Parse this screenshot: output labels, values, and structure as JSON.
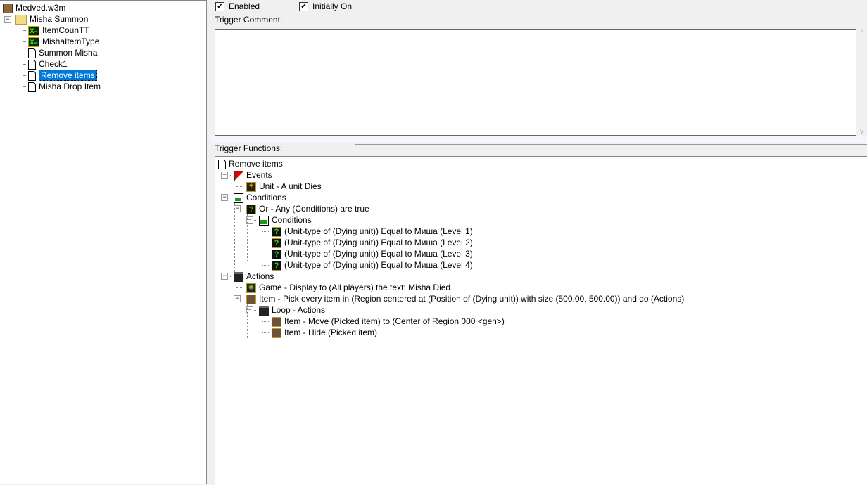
{
  "left_tree": {
    "root": "Medved.w3m",
    "folder": "Misha Summon",
    "items": [
      {
        "label": "ItemCounTT",
        "icon": "variable-icon"
      },
      {
        "label": "MishaItemType",
        "icon": "variable-icon"
      },
      {
        "label": "Summon Misha",
        "icon": "trigger-icon"
      },
      {
        "label": "Check1",
        "icon": "trigger-icon"
      },
      {
        "label": "Remove items",
        "icon": "trigger-icon",
        "selected": true
      },
      {
        "label": "Misha Drop Item",
        "icon": "trigger-icon"
      }
    ]
  },
  "options": {
    "enabled_label": "Enabled",
    "enabled": true,
    "initially_on_label": "Initially On",
    "initially_on": true
  },
  "comment": {
    "label": "Trigger Comment:",
    "value": ""
  },
  "functions": {
    "label": "Trigger Functions:",
    "rows": [
      {
        "text": "Remove items",
        "level": 0,
        "icon": "doc"
      },
      {
        "text": "Events",
        "level": 1,
        "icon": "flag",
        "exp": true
      },
      {
        "text": "Unit - A unit Dies",
        "level": 2,
        "icon": "unit"
      },
      {
        "text": "Conditions",
        "level": 1,
        "icon": "cond",
        "exp": true
      },
      {
        "text": "Or - Any (Conditions) are true",
        "level": 2,
        "icon": "q",
        "exp": true
      },
      {
        "text": "Conditions",
        "level": 3,
        "icon": "cond",
        "exp": true
      },
      {
        "text": "(Unit-type of (Dying unit)) Equal to Миша (Level 1)",
        "level": 4,
        "icon": "q"
      },
      {
        "text": "(Unit-type of (Dying unit)) Equal to Миша (Level 2)",
        "level": 4,
        "icon": "q"
      },
      {
        "text": "(Unit-type of (Dying unit)) Equal to Миша (Level 3)",
        "level": 4,
        "icon": "q"
      },
      {
        "text": "(Unit-type of (Dying unit)) Equal to Миша (Level 4)",
        "level": 4,
        "icon": "q"
      },
      {
        "text": "Actions",
        "level": 1,
        "icon": "clap",
        "exp": true
      },
      {
        "text": "Game - Display to (All players) the text: Misha Died",
        "level": 2,
        "icon": "game"
      },
      {
        "text": "Item - Pick every item in (Region centered at (Position of (Dying unit)) with size (500.00, 500.00)) and do (Actions)",
        "level": 2,
        "icon": "item",
        "exp": true
      },
      {
        "text": "Loop - Actions",
        "level": 3,
        "icon": "clap",
        "exp": true
      },
      {
        "text": "Item - Move (Picked item) to (Center of Region 000 <gen>)",
        "level": 4,
        "icon": "item"
      },
      {
        "text": "Item - Hide (Picked item)",
        "level": 4,
        "icon": "item"
      }
    ]
  }
}
